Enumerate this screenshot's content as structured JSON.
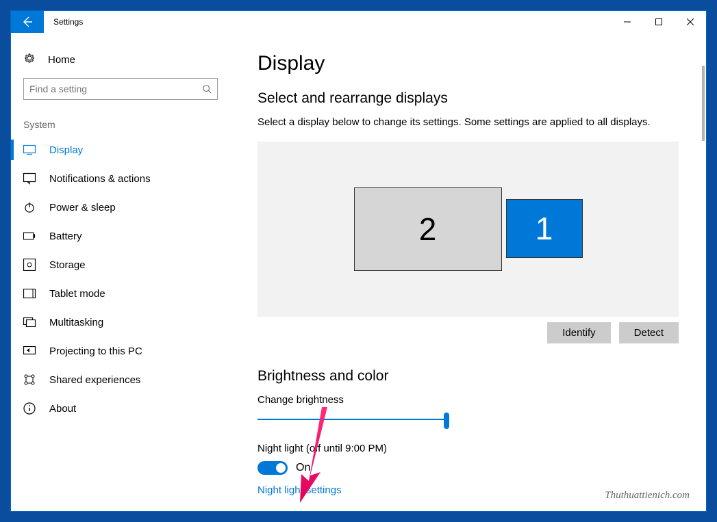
{
  "window": {
    "title": "Settings"
  },
  "sidebar": {
    "home": "Home",
    "search_placeholder": "Find a setting",
    "section": "System",
    "items": [
      {
        "label": "Display",
        "icon": "display"
      },
      {
        "label": "Notifications & actions",
        "icon": "notifications"
      },
      {
        "label": "Power & sleep",
        "icon": "power"
      },
      {
        "label": "Battery",
        "icon": "battery"
      },
      {
        "label": "Storage",
        "icon": "storage"
      },
      {
        "label": "Tablet mode",
        "icon": "tablet"
      },
      {
        "label": "Multitasking",
        "icon": "multitasking"
      },
      {
        "label": "Projecting to this PC",
        "icon": "projecting"
      },
      {
        "label": "Shared experiences",
        "icon": "shared"
      },
      {
        "label": "About",
        "icon": "about"
      }
    ]
  },
  "main": {
    "title": "Display",
    "arrange": {
      "heading": "Select and rearrange displays",
      "desc": "Select a display below to change its settings. Some settings are applied to all displays.",
      "monitors": {
        "primary": "2",
        "secondary": "1"
      },
      "identify": "Identify",
      "detect": "Detect"
    },
    "brightness": {
      "heading": "Brightness and color",
      "change_label": "Change brightness",
      "slider_value": 100,
      "night_light_label": "Night light (off until 9:00 PM)",
      "toggle_state": "On",
      "settings_link": "Night light settings"
    }
  },
  "watermark": "Thuthuattienich.com"
}
